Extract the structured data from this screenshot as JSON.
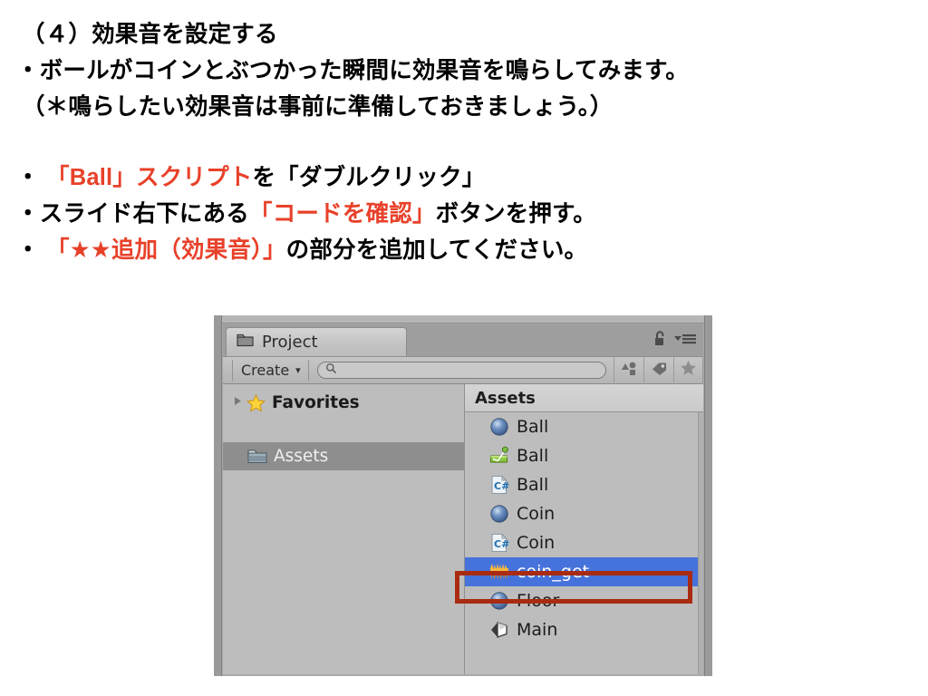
{
  "slide": {
    "lines": [
      {
        "id": "heading",
        "indent": "head",
        "segments": [
          {
            "text": "（４）効果音を設定する",
            "color": "black"
          }
        ]
      },
      {
        "id": "intro-1",
        "indent": "bullet",
        "segments": [
          {
            "text": "・ボールがコインとぶつかった瞬間に効果音を鳴らしてみます。",
            "color": "black"
          }
        ]
      },
      {
        "id": "intro-2",
        "indent": "head",
        "segments": [
          {
            "text": "（＊鳴らしたい効果音は事前に準備しておきましょう。）",
            "color": "black"
          }
        ]
      },
      {
        "id": "step-1",
        "indent": "bullet",
        "segments": [
          {
            "text": "・ ",
            "color": "black"
          },
          {
            "text": "「Ball」スクリプト",
            "color": "red"
          },
          {
            "text": "を「ダブルクリック」",
            "color": "black"
          }
        ]
      },
      {
        "id": "step-2",
        "indent": "bullet",
        "segments": [
          {
            "text": "・スライド右下にある",
            "color": "black"
          },
          {
            "text": "「コードを確認」",
            "color": "red"
          },
          {
            "text": "ボタンを押す。",
            "color": "black"
          }
        ]
      },
      {
        "id": "step-3",
        "indent": "bullet",
        "segments": [
          {
            "text": "・ ",
            "color": "black"
          },
          {
            "text": "「★★追加（効果音）」",
            "color": "red"
          },
          {
            "text": "の部分を追加してください。",
            "color": "black"
          }
        ]
      }
    ],
    "accent_color": "#e8412a",
    "text_color": "#000000"
  },
  "unity": {
    "tab": {
      "label": "Project",
      "icon": "folder-icon"
    },
    "tab_controls": [
      {
        "name": "lock-icon",
        "label": ""
      },
      {
        "name": "panel-menu-icon",
        "label": ""
      }
    ],
    "toolbar": {
      "create_label": "Create",
      "create_caret": "▾",
      "search_value": "",
      "search_placeholder": "",
      "buttons": [
        {
          "name": "filter-by-type-button",
          "icon": "shapes-icon"
        },
        {
          "name": "filter-by-label-button",
          "icon": "tag-icon"
        },
        {
          "name": "filter-favorites-button",
          "icon": "star-icon"
        }
      ]
    },
    "tree": {
      "items": [
        {
          "label": "Favorites",
          "icon": "star-icon",
          "expandable": true,
          "selected": false
        },
        {
          "label": "Assets",
          "icon": "folder-icon",
          "expandable": false,
          "selected": true
        }
      ]
    },
    "list": {
      "header": "Assets",
      "items": [
        {
          "label": "Ball",
          "icon": "prefab-sphere-icon",
          "selected": false
        },
        {
          "label": "Ball",
          "icon": "physics-material-icon",
          "selected": false
        },
        {
          "label": "Ball",
          "icon": "csharp-script-icon",
          "selected": false
        },
        {
          "label": "Coin",
          "icon": "prefab-sphere-icon",
          "selected": false
        },
        {
          "label": "Coin",
          "icon": "csharp-script-icon",
          "selected": false
        },
        {
          "label": "coin_get",
          "icon": "audio-clip-icon",
          "selected": true
        },
        {
          "label": "Floor",
          "icon": "prefab-sphere-icon",
          "selected": false
        },
        {
          "label": "Main",
          "icon": "unity-scene-icon",
          "selected": false
        }
      ]
    },
    "annotation": {
      "name": "coin-get-highlight-box",
      "color": "#a92b11"
    },
    "colors": {
      "panel_bg": "#bdbdbd",
      "toolbar_bg": "#bebebe",
      "selection_blue": "#4673db",
      "tree_selection": "#8e8e8e"
    }
  }
}
